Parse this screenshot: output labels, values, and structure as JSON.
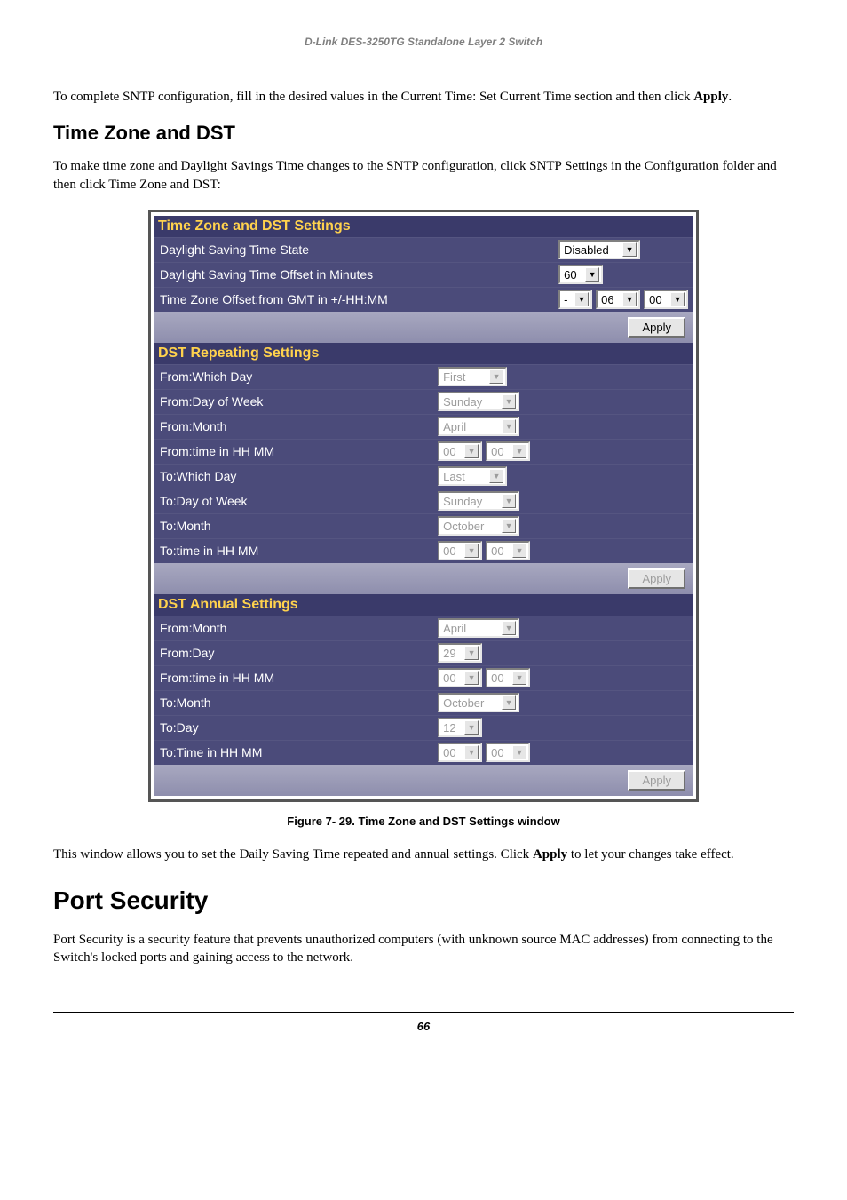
{
  "header": "D-Link DES-3250TG Standalone Layer 2 Switch",
  "para1_a": "To complete SNTP configuration, fill in the desired values in the Current Time: Set Current Time section and then click ",
  "para1_b": "Apply",
  "para1_c": ".",
  "section1_heading": "Time Zone and DST",
  "para2": "To make time zone and Daylight Savings Time changes to the SNTP configuration, click SNTP Settings in the Configuration folder and then click Time Zone and DST:",
  "panel": {
    "s1_title": "Time Zone and DST Settings",
    "s1_rows": {
      "r1_label": "Daylight Saving Time State",
      "r1_val": "Disabled",
      "r2_label": "Daylight Saving Time Offset in Minutes",
      "r2_val": "60",
      "r3_label": "Time Zone Offset:from GMT in +/-HH:MM",
      "r3_sign": "-",
      "r3_hh": "06",
      "r3_mm": "00"
    },
    "apply1": "Apply",
    "s2_title": "DST Repeating Settings",
    "s2_rows": {
      "r1_label": "From:Which Day",
      "r1_val": "First",
      "r2_label": "From:Day of Week",
      "r2_val": "Sunday",
      "r3_label": "From:Month",
      "r3_val": "April",
      "r4_label": "From:time in HH MM",
      "r4_hh": "00",
      "r4_mm": "00",
      "r5_label": "To:Which Day",
      "r5_val": "Last",
      "r6_label": "To:Day of Week",
      "r6_val": "Sunday",
      "r7_label": "To:Month",
      "r7_val": "October",
      "r8_label": "To:time in HH MM",
      "r8_hh": "00",
      "r8_mm": "00"
    },
    "apply2": "Apply",
    "s3_title": "DST Annual Settings",
    "s3_rows": {
      "r1_label": "From:Month",
      "r1_val": "April",
      "r2_label": "From:Day",
      "r2_val": "29",
      "r3_label": "From:time in HH MM",
      "r3_hh": "00",
      "r3_mm": "00",
      "r4_label": "To:Month",
      "r4_val": "October",
      "r5_label": "To:Day",
      "r5_val": "12",
      "r6_label": "To:Time in HH MM",
      "r6_hh": "00",
      "r6_mm": "00"
    },
    "apply3": "Apply"
  },
  "figure_caption": "Figure 7- 29.  Time Zone and DST Settings window",
  "para3_a": "This window allows you to set the Daily Saving Time repeated and annual settings. Click ",
  "para3_b": "Apply",
  "para3_c": " to let your changes take effect.",
  "section2_heading": "Port Security",
  "para4": "Port Security is a security feature that prevents unauthorized computers (with unknown source MAC addresses) from connecting to the Switch's locked ports and gaining access to the network.",
  "page_num": "66"
}
